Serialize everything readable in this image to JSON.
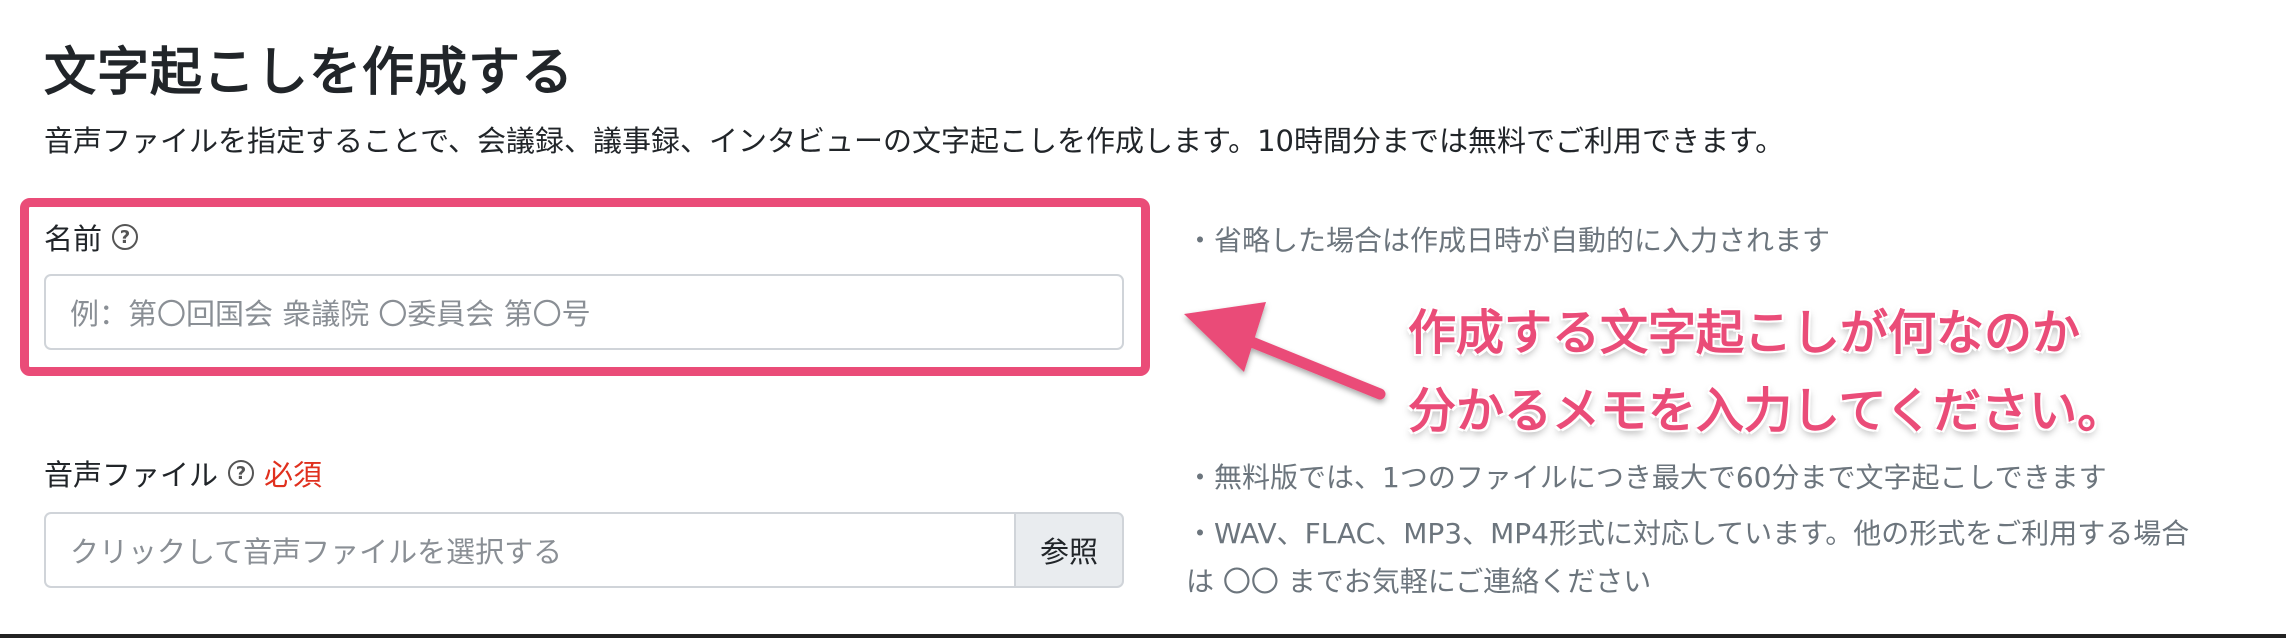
{
  "page": {
    "title": "文字起こしを作成する",
    "description": "音声ファイルを指定することで、会議録、議事録、インタビューの文字起こしを作成します。10時間分までは無料でご利用できます。"
  },
  "name_field": {
    "label": "名前",
    "help_icon": "question-circle-icon",
    "placeholder": "例：第〇回国会 衆議院 〇委員会 第〇号",
    "hint": "・省略した場合は作成日時が自動的に入力されます"
  },
  "audio_field": {
    "label": "音声ファイル",
    "help_icon": "question-circle-icon",
    "required_label": "必須",
    "placeholder": "クリックして音声ファイルを選択する",
    "browse_label": "参照",
    "hints": [
      "・無料版では、1つのファイルにつき最大で60分まで文字起こしできます",
      "・WAV、FLAC、MP3、MP4形式に対応しています。他の形式をご利用する場合",
      "は 〇〇 までお気軽にご連絡ください"
    ]
  },
  "annotation": {
    "lines": [
      "作成する文字起こしが何なのか",
      "分かるメモを入力してください。"
    ],
    "color": "#ea4c78"
  },
  "colors": {
    "required": "#e0301e",
    "highlight": "#ea4c78"
  }
}
